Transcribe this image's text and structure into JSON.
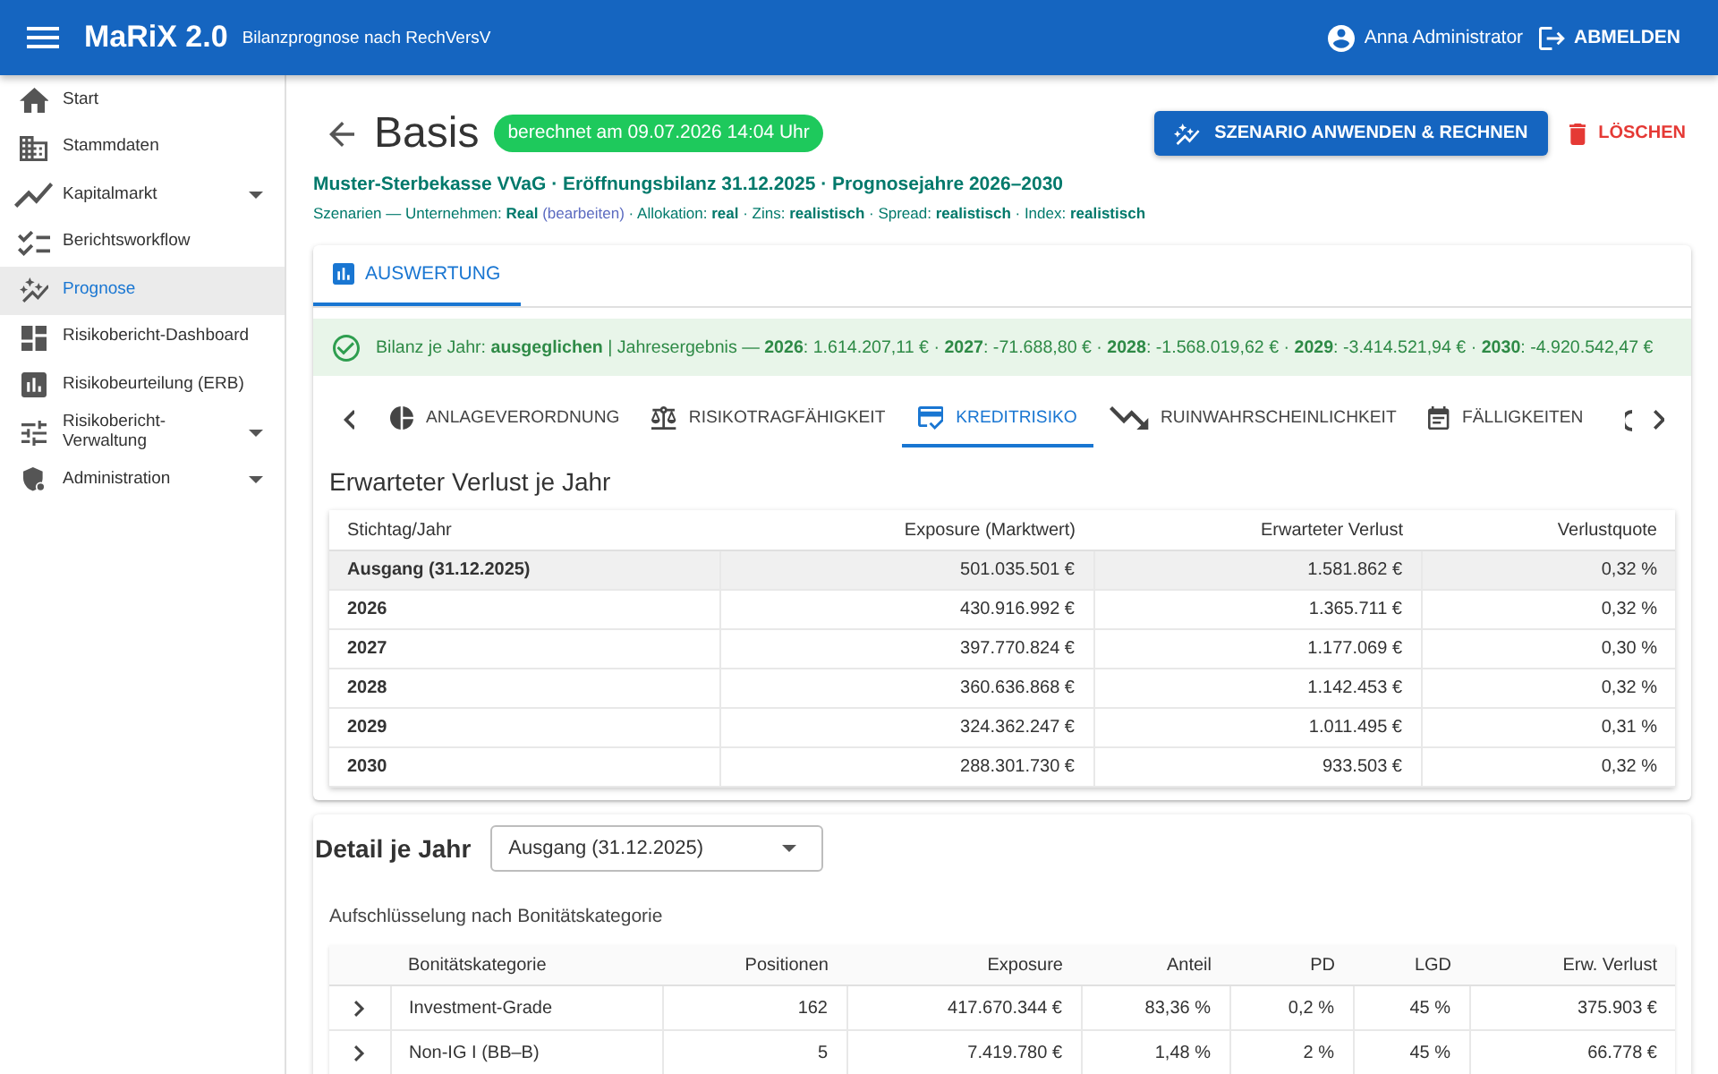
{
  "app_bar": {
    "title": "MaRiX 2.0",
    "subtitle": "Bilanzprognose nach RechVersV",
    "user": "Anna Administrator",
    "logout": "ABMELDEN"
  },
  "sidebar": {
    "items": [
      {
        "label": "Start",
        "selected": false,
        "expandable": false
      },
      {
        "label": "Stammdaten",
        "selected": false,
        "expandable": false
      },
      {
        "label": "Kapitalmarkt",
        "selected": false,
        "expandable": true
      },
      {
        "label": "Berichtsworkflow",
        "selected": false,
        "expandable": false
      },
      {
        "label": "Prognose",
        "selected": true,
        "expandable": false
      },
      {
        "label": "Risikobericht-Dashboard",
        "selected": false,
        "expandable": false
      },
      {
        "label": "Risikobeurteilung (ERB)",
        "selected": false,
        "expandable": false
      },
      {
        "label": "Risikobericht-Verwaltung",
        "selected": false,
        "expandable": true
      },
      {
        "label": "Administration",
        "selected": false,
        "expandable": true
      }
    ]
  },
  "page": {
    "title": "Basis",
    "status": "berechnet am 09.07.2026 14:04 Uhr",
    "primary_action": "SZENARIO ANWENDEN & RECHNEN",
    "delete_action": "LÖSCHEN",
    "context": "Muster-Sterbekasse VVaG · Eröffnungsbilanz 31.12.2025 · Prognosejahre 2026–2030",
    "scenario": {
      "before": "Szenarien — Unternehmen: **Real**",
      "link": "(bearbeiten)",
      "after": "· Allokation: **real** · Zins: **realistisch** · Spread: **realistisch** · Index: **realistisch**"
    }
  },
  "result_card": {
    "tabs": [
      {
        "label": "AUSWERTUNG",
        "selected": true
      }
    ],
    "banner": "Bilanz je Jahr: **ausgeglichen** | Jahresergebnis — **2026**: 1.614.207,11 € · **2027**: -71.688,80 € · **2028**: -1.568.019,62 € · **2029**: -3.414.521,94 € · **2030**: -4.920.542,47 €",
    "sub_tabs": [
      {
        "label": "ANLAGEVERORDNUNG",
        "selected": false
      },
      {
        "label": "RISIKOTRAGFÄHIGKEIT",
        "selected": false
      },
      {
        "label": "KREDITRISIKO",
        "selected": true
      },
      {
        "label": "RUINWAHRSCHEINLICHKEIT",
        "selected": false
      },
      {
        "label": "FÄLLIGKEITEN",
        "selected": false
      }
    ],
    "section_title": "Erwarteter Verlust je Jahr",
    "table": {
      "columns": [
        "Stichtag/Jahr",
        "Exposure (Marktwert)",
        "Erwarteter Verlust",
        "Verlustquote"
      ],
      "rows": [
        {
          "cells": [
            "Ausgang (31.12.2025)",
            "501.035.501 €",
            "1.581.862 €",
            "0,32 %"
          ],
          "highlighted": true
        },
        {
          "cells": [
            "2026",
            "430.916.992 €",
            "1.365.711 €",
            "0,32 %"
          ],
          "highlighted": false
        },
        {
          "cells": [
            "2027",
            "397.770.824 €",
            "1.177.069 €",
            "0,30 %"
          ],
          "highlighted": false
        },
        {
          "cells": [
            "2028",
            "360.636.868 €",
            "1.142.453 €",
            "0,32 %"
          ],
          "highlighted": false
        },
        {
          "cells": [
            "2029",
            "324.362.247 €",
            "1.011.495 €",
            "0,31 %"
          ],
          "highlighted": false
        },
        {
          "cells": [
            "2030",
            "288.301.730 €",
            "933.503 €",
            "0,32 %"
          ],
          "highlighted": false
        }
      ]
    }
  },
  "detail": {
    "title": "Detail je Jahr",
    "select": {
      "value": "Ausgang (31.12.2025)"
    },
    "caption": "Aufschlüsselung nach Bonitätskategorie",
    "table": {
      "columns": [
        "Bonitätskategorie",
        "Positionen",
        "Exposure",
        "Anteil",
        "PD",
        "LGD",
        "Erw. Verlust"
      ],
      "rows": [
        {
          "cells": [
            "Investment-Grade",
            "162",
            "417.670.344 €",
            "83,36 %",
            "0,2 %",
            "45 %",
            "375.903 €"
          ],
          "expanded": false
        },
        {
          "cells": [
            "Non-IG I (BB–B)",
            "5",
            "7.419.780 €",
            "1,48 %",
            "2 %",
            "45 %",
            "66.778 €"
          ],
          "expanded": false
        }
      ]
    }
  }
}
